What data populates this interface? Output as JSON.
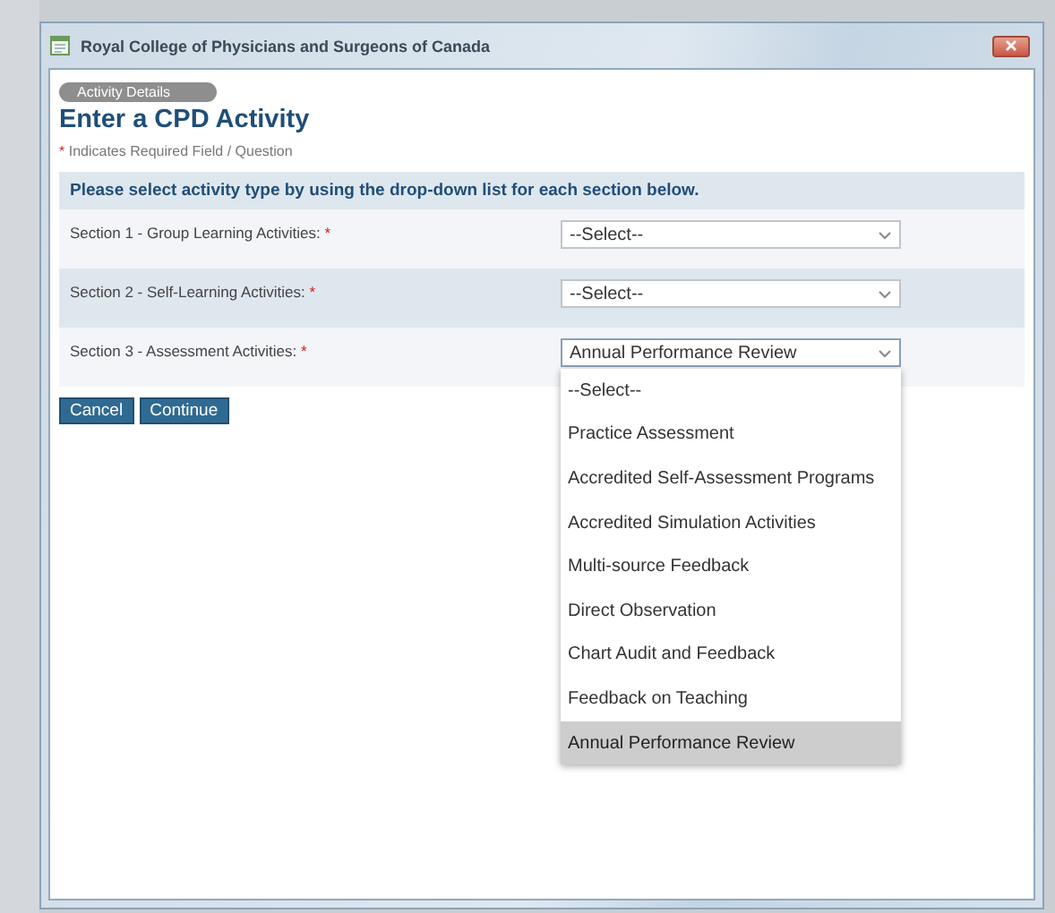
{
  "window": {
    "title": "Royal College of Physicians and Surgeons of Canada"
  },
  "badge": "Activity Details",
  "heading": "Enter a CPD Activity",
  "required_note": {
    "mark": "*",
    "text": "Indicates Required Field / Question"
  },
  "instruction": "Please select activity type by using the drop-down list for each section below.",
  "sections": [
    {
      "label": "Section 1 - Group Learning Activities:",
      "required_mark": "*",
      "value": "--Select--",
      "expanded": false
    },
    {
      "label": "Section 2 - Self-Learning Activities:",
      "required_mark": "*",
      "value": "--Select--",
      "expanded": false
    },
    {
      "label": "Section 3 - Assessment Activities:",
      "required_mark": "*",
      "value": "Annual Performance Review",
      "expanded": true,
      "options": [
        {
          "label": "--Select--",
          "selected": false
        },
        {
          "label": "Practice Assessment",
          "selected": false
        },
        {
          "label": "Accredited Self-Assessment Programs",
          "selected": false
        },
        {
          "label": "Accredited Simulation Activities",
          "selected": false
        },
        {
          "label": "Multi-source Feedback",
          "selected": false
        },
        {
          "label": "Direct Observation",
          "selected": false
        },
        {
          "label": "Chart Audit and Feedback",
          "selected": false
        },
        {
          "label": "Feedback on Teaching",
          "selected": false
        },
        {
          "label": "Annual Performance Review",
          "selected": true
        }
      ]
    }
  ],
  "buttons": [
    "Cancel",
    "Continue"
  ]
}
